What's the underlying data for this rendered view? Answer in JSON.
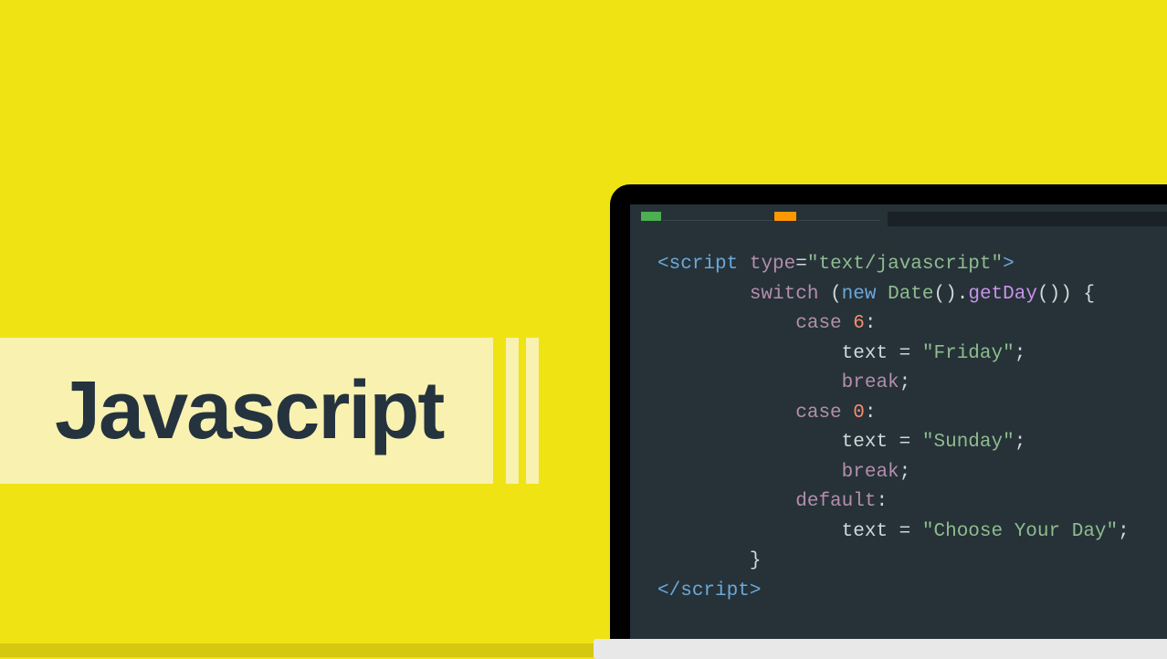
{
  "title": "Javascript",
  "code": {
    "line1": {
      "open": "<",
      "tag": "script",
      "space": " ",
      "attr": "type",
      "eq": "=",
      "val": "\"text/javascript\"",
      "close": ">"
    },
    "line2": {
      "kw": "switch",
      "sp": " ",
      "lp": "(",
      "new": "new",
      "sp2": " ",
      "cls": "Date",
      "par": "()",
      "dot": ".",
      "method": "getDay",
      "par2": "()",
      "rp": ")",
      "sp3": " ",
      "brace": "{"
    },
    "line3": {
      "case": "case",
      "sp": " ",
      "num": "6",
      "colon": ":"
    },
    "line4": {
      "var": "text",
      "sp": " ",
      "eq": "=",
      "sp2": " ",
      "str": "\"Friday\"",
      "semi": ";"
    },
    "line5": {
      "break": "break",
      "semi": ";"
    },
    "line6": {
      "case": "case",
      "sp": " ",
      "num": "0",
      "colon": ":"
    },
    "line7": {
      "var": "text",
      "sp": " ",
      "eq": "=",
      "sp2": " ",
      "str": "\"Sunday\"",
      "semi": ";"
    },
    "line8": {
      "break": "break",
      "semi": ";"
    },
    "line9": {
      "default": "default",
      "colon": ":"
    },
    "line10": {
      "var": "text",
      "sp": " ",
      "eq": "=",
      "sp2": " ",
      "str": "\"Choose Your Day\"",
      "semi": ";"
    },
    "line11": {
      "brace": "}"
    },
    "line12": {
      "open": "</",
      "tag": "script",
      "close": ">"
    }
  }
}
